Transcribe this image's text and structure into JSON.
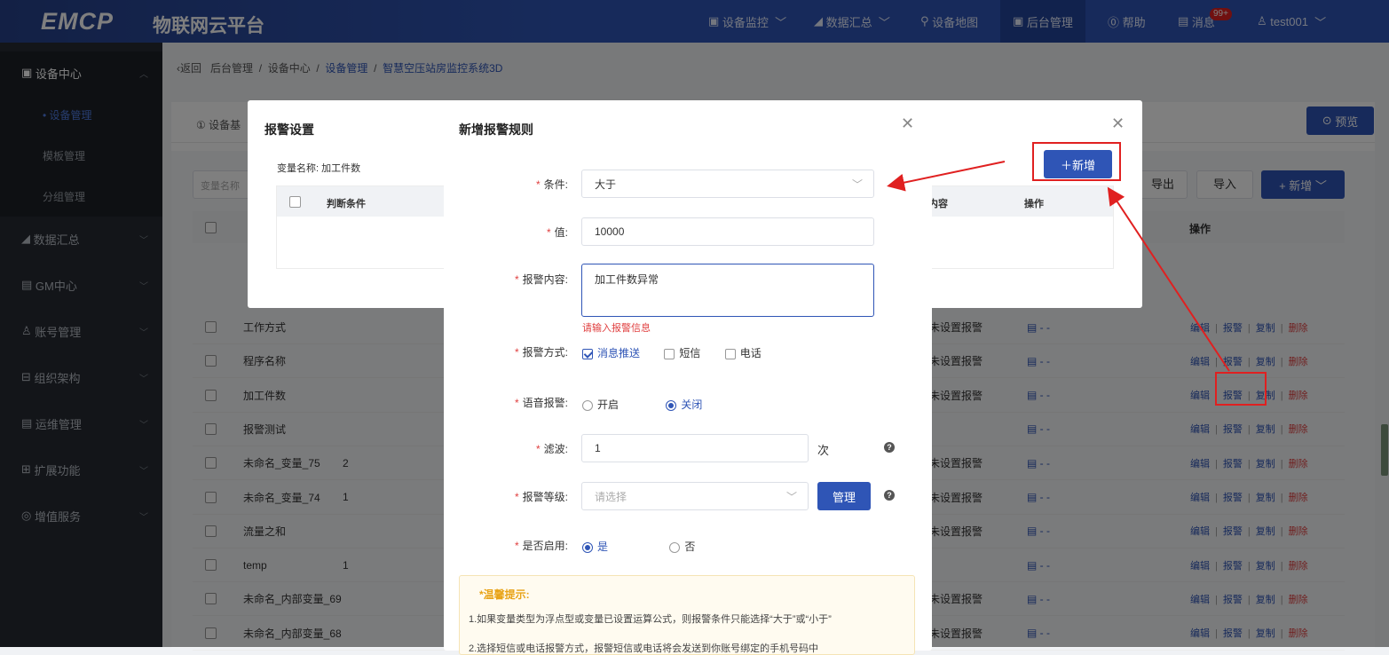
{
  "header": {
    "logo": "EMCP",
    "platform": "物联网云平台",
    "nav": {
      "monitor": "设备监控",
      "data": "数据汇总",
      "map": "设备地图",
      "admin": "后台管理",
      "help": "帮助",
      "messages": "消息",
      "badge": "99+",
      "user": "test001"
    }
  },
  "sidebar": {
    "device_center": "设备中心",
    "device_mgmt": "• 设备管理",
    "template_mgmt": "模板管理",
    "group_mgmt": "分组管理",
    "data_summary": "数据汇总",
    "gm_center": "GM中心",
    "account_mgmt": "账号管理",
    "org": "组织架构",
    "ops": "运维管理",
    "ext": "扩展功能",
    "vas": "增值服务"
  },
  "breadcrumb": {
    "back": "返回",
    "c1": "后台管理",
    "c2": "设备中心",
    "c3": "设备管理",
    "c4": "智慧空压站房监控系统3D"
  },
  "page": {
    "tab_basic": "① 设备基",
    "preview": "预览",
    "search_placeholder": "变量名称",
    "export": "导出",
    "import": "导入",
    "add_dropdown": "+ 新增",
    "col_ops": "操作"
  },
  "table": {
    "rows": [
      {
        "name": "工作方式",
        "c2": "",
        "alarm": "未设置报警"
      },
      {
        "name": "程序名称",
        "c2": "",
        "alarm": "未设置报警"
      },
      {
        "name": "加工件数",
        "c2": "",
        "alarm": "未设置报警"
      },
      {
        "name": "报警测试",
        "c2": "",
        "alarm": ""
      },
      {
        "name": "未命名_变量_75",
        "c2": "2",
        "alarm": "未设置报警"
      },
      {
        "name": "未命名_变量_74",
        "c2": "1",
        "alarm": "未设置报警"
      },
      {
        "name": "流量之和",
        "c2": "",
        "alarm": "未设置报警"
      },
      {
        "name": "temp",
        "c2": "1",
        "alarm": ""
      },
      {
        "name": "未命名_内部变量_69",
        "c2": "",
        "alarm": "未设置报警"
      },
      {
        "name": "未命名_内部变量_68",
        "c2": "",
        "alarm": "未设置报警"
      }
    ],
    "ops": {
      "edit": "编辑",
      "alarm": "报警",
      "copy": "复制",
      "del": "删除"
    },
    "dash": "- -"
  },
  "alarm_settings": {
    "title": "报警设置",
    "var_label": "变量名称: 加工件数",
    "col_condition": "判断条件",
    "col_content": "内容",
    "col_ops": "操作",
    "add_button": "新增"
  },
  "rule_modal": {
    "title": "新增报警规则",
    "condition_label": "条件:",
    "condition_value": "大于",
    "value_label": "值:",
    "value_value": "10000",
    "content_label": "报警内容:",
    "content_value": "加工件数异常",
    "content_error": "请输入报警信息",
    "method_label": "报警方式:",
    "method_push": "消息推送",
    "method_sms": "短信",
    "method_phone": "电话",
    "voice_label": "语音报警:",
    "voice_on": "开启",
    "voice_off": "关闭",
    "filter_label": "滤波:",
    "filter_value": "1",
    "filter_unit": "次",
    "level_label": "报警等级:",
    "level_placeholder": "请选择",
    "manage": "管理",
    "enable_label": "是否启用:",
    "enable_yes": "是",
    "enable_no": "否",
    "tip_title": "*温馨提示:",
    "tip_1": "1.如果变量类型为浮点型或变量已设置运算公式，则报警条件只能选择“大于”或“小于”",
    "tip_2": "2.选择短信或电话报警方式，报警短信或电话将会发送到你账号绑定的手机号码中"
  },
  "colors": {
    "primary": "#2f55b6",
    "danger": "#e02020"
  }
}
